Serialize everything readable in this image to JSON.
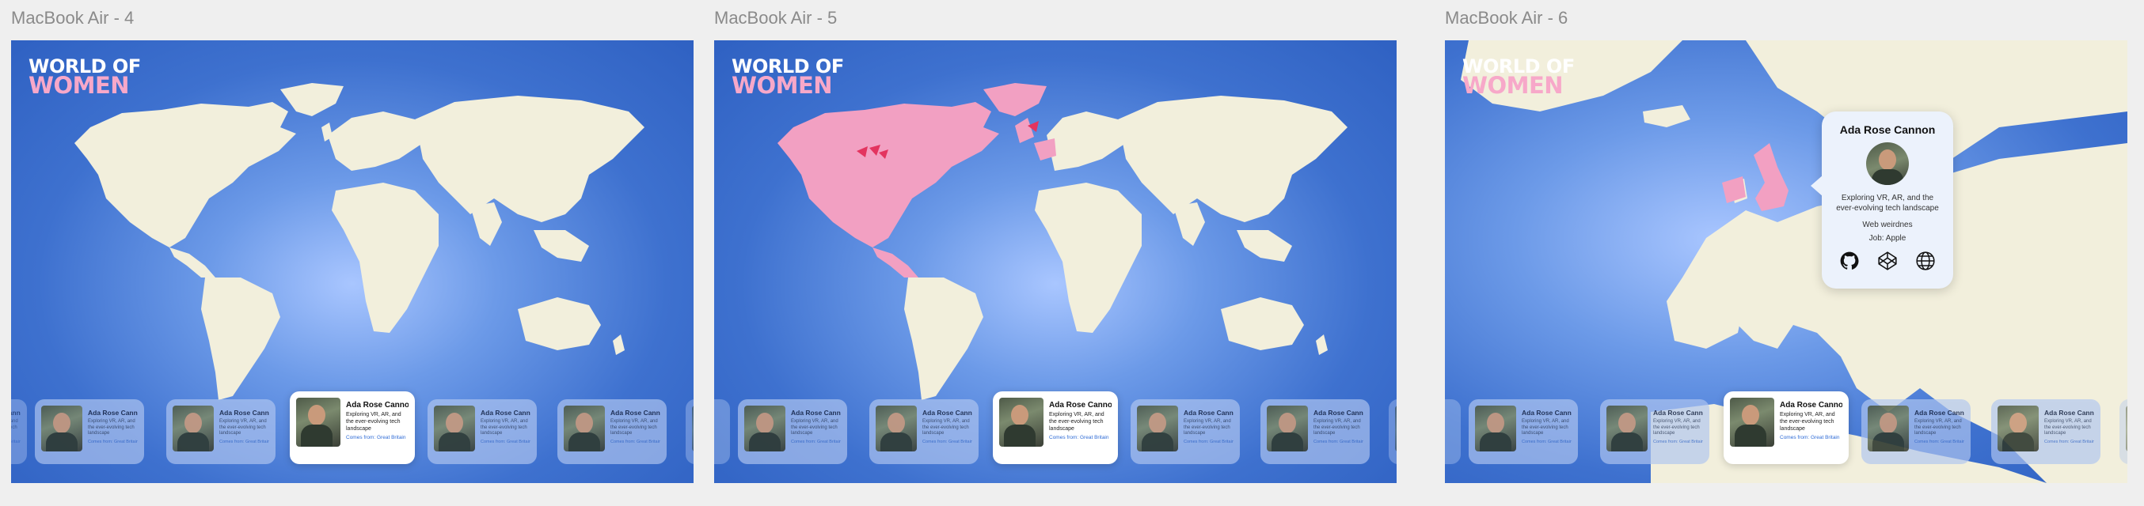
{
  "frames": [
    {
      "label": "MacBook Air - 4"
    },
    {
      "label": "MacBook Air - 5"
    },
    {
      "label": "MacBook Air - 6"
    }
  ],
  "logo": {
    "line1": "WORLD OF",
    "line2": "WOMEN"
  },
  "card": {
    "name": "Ada Rose Cannon",
    "description": "Exploring VR, AR, and the ever-evolving tech landscape",
    "origin": "Comes from: Great Britain"
  },
  "popup": {
    "name": "Ada Rose Cannon",
    "description": "Exploring VR, AR, and the ever-evolving tech landscape",
    "tagline": "Web weirdnes",
    "job": "Job: Apple",
    "icons": [
      "github-icon",
      "codepen-icon",
      "globe-icon"
    ]
  },
  "colors": {
    "ocean": "#3e71cf",
    "land": "#f2efdc",
    "highlight": "#f2a0c2",
    "pin": "#e3345f",
    "logo_accent": "#f7a8c9"
  }
}
